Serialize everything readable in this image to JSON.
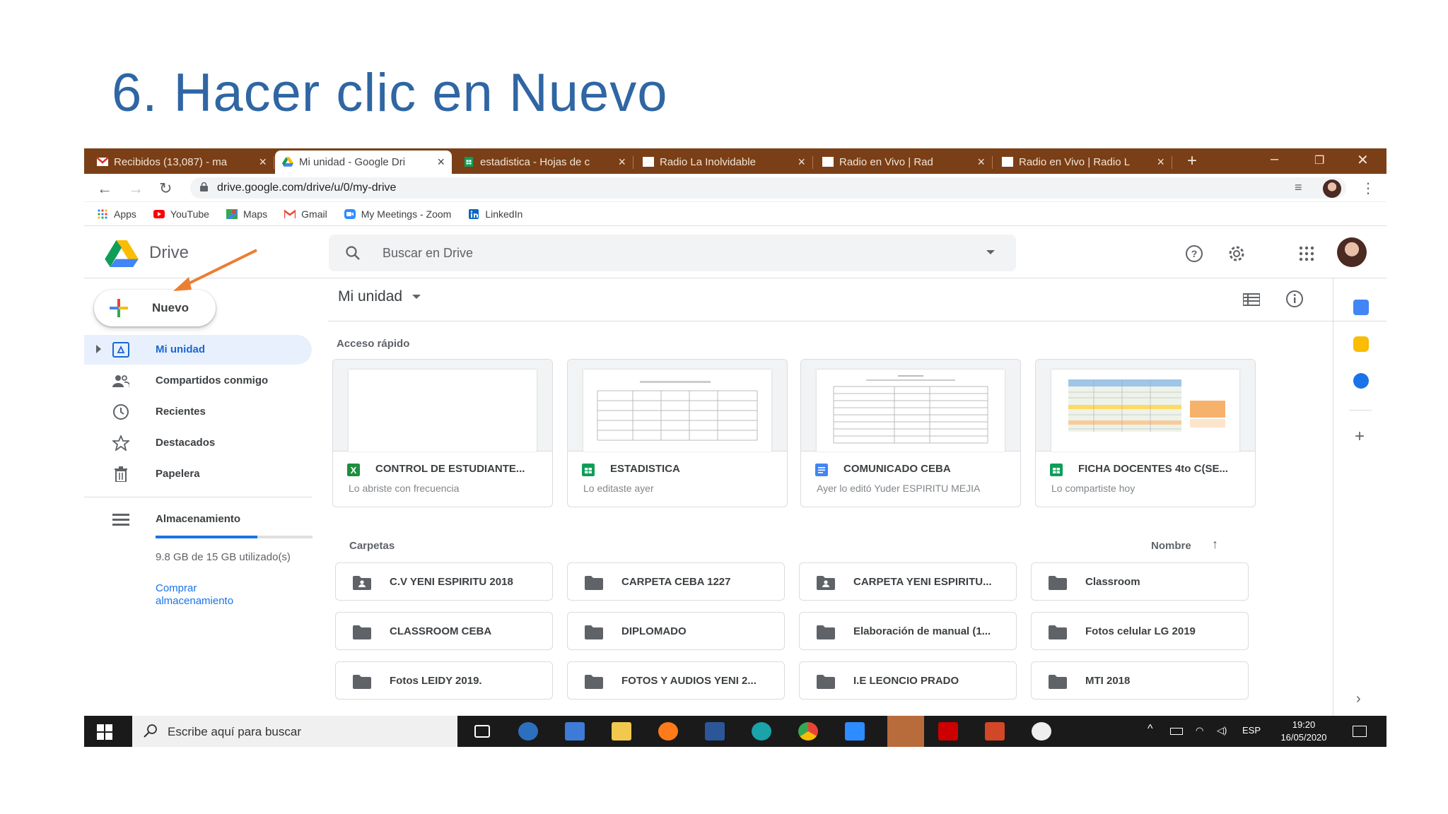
{
  "slide": {
    "title": "6. Hacer clic en Nuevo"
  },
  "browser": {
    "tabs": [
      {
        "label": "Recibidos (13,087) - ma"
      },
      {
        "label": "Mi unidad - Google Dri"
      },
      {
        "label": "estadistica - Hojas de c"
      },
      {
        "label": "Radio La Inolvidable"
      },
      {
        "label": "Radio en Vivo | Rad"
      },
      {
        "label": "Radio en Vivo | Radio L"
      }
    ],
    "new_tab": "+",
    "url": "drive.google.com/drive/u/0/my-drive",
    "bookmarks": [
      {
        "label": "Apps"
      },
      {
        "label": "YouTube"
      },
      {
        "label": "Maps"
      },
      {
        "label": "Gmail"
      },
      {
        "label": "My Meetings - Zoom"
      },
      {
        "label": "LinkedIn"
      }
    ]
  },
  "drive": {
    "product_name": "Drive",
    "search_placeholder": "Buscar en Drive",
    "new_button": "Nuevo",
    "sidebar": [
      {
        "label": "Mi unidad"
      },
      {
        "label": "Compartidos conmigo"
      },
      {
        "label": "Recientes"
      },
      {
        "label": "Destacados"
      },
      {
        "label": "Papelera"
      }
    ],
    "storage": {
      "label": "Almacenamiento",
      "usage": "9.8 GB de 15 GB utilizado(s)",
      "used_fraction": 0.65,
      "buy_line1": "Comprar",
      "buy_line2": "almacenamiento"
    },
    "main_title": "Mi unidad",
    "quick_access_label": "Acceso rápido",
    "quick_access": [
      {
        "name": "CONTROL DE ESTUDIANTE...",
        "sub": "Lo abriste con frecuencia"
      },
      {
        "name": "ESTADISTICA",
        "sub": "Lo editaste ayer"
      },
      {
        "name": "COMUNICADO CEBA",
        "sub": "Ayer lo editó Yuder ESPIRITU MEJIA"
      },
      {
        "name": "FICHA DOCENTES 4to C(SE...",
        "sub": "Lo compartiste hoy"
      }
    ],
    "folders_label": "Carpetas",
    "sort_label": "Nombre",
    "sort_arrow": "↑",
    "folders": [
      {
        "name": "C.V YENI ESPIRITU 2018"
      },
      {
        "name": "CARPETA CEBA 1227"
      },
      {
        "name": "CARPETA YENI ESPIRITU..."
      },
      {
        "name": "Classroom"
      },
      {
        "name": "CLASSROOM CEBA"
      },
      {
        "name": "DIPLOMADO"
      },
      {
        "name": "Elaboración de manual (1..."
      },
      {
        "name": "Fotos celular LG 2019"
      },
      {
        "name": "Fotos LEIDY 2019."
      },
      {
        "name": "FOTOS Y AUDIOS YENI 2..."
      },
      {
        "name": "I.E LEONCIO PRADO"
      },
      {
        "name": "MTI 2018"
      }
    ]
  },
  "taskbar": {
    "search_placeholder": "Escribe aquí para buscar",
    "language": "ESP",
    "time": "19:20",
    "date": "16/05/2020"
  }
}
